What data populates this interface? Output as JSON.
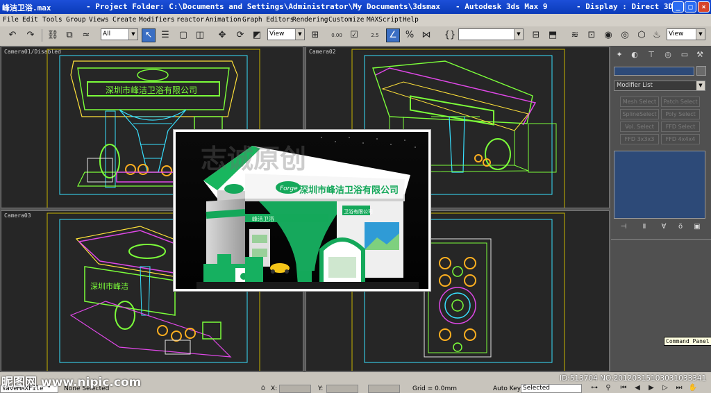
{
  "titlebar": {
    "file": "峰洁卫浴.max",
    "project": "- Project Folder: C:\\Documents and Settings\\Administrator\\My Documents\\3dsmax",
    "app": "- Autodesk 3ds Max 9",
    "display": "- Display : Direct 3D",
    "min_label": "_",
    "max_label": "□",
    "close_label": "×"
  },
  "menubar": [
    "File",
    "Edit",
    "Tools",
    "Group",
    "Views",
    "Create",
    "Modifiers",
    "reactor",
    "Animation",
    "Graph Editors",
    "Rendering",
    "Customize",
    "MAXScript",
    "Help"
  ],
  "toolbar": {
    "selection_filter": "All",
    "ref_coord": "View",
    "spinner_value": "0.00",
    "snap_value": "2.5",
    "named_selection": "",
    "view_right": "View"
  },
  "viewports": {
    "top_left": "Camera01/Disabled",
    "top_right": "Camera02",
    "bottom_left": "Camera03",
    "bottom_right": ""
  },
  "command_panel": {
    "modifier_list": "Modifier List",
    "buttons": [
      "Mesh Select",
      "Patch Select",
      "SplineSelect",
      "Poly Select",
      "Vol. Select",
      "FFD Select",
      "FFD 3x3x3",
      "FFD 4x4x4"
    ],
    "tooltip": "Command Panel"
  },
  "render": {
    "sign_logo": "Forge",
    "sign_company": "深圳市峰洁卫浴有限公司",
    "side_sign": "卫浴有限公司",
    "front_sign": "峰洁卫浴",
    "watermark": "志诚原创"
  },
  "statusbar": {
    "script": "saveMAXFile \"",
    "selection": "None Selected",
    "x_label": "X:",
    "y_label": "Y:",
    "grid": "Grid = 0.0mm",
    "autokey": "Auto Key",
    "selected": "Selected"
  },
  "watermarks": {
    "left": "昵图网 www.nipic.com",
    "right": "ID:513704 NO:20120315103031033341"
  },
  "colors": {
    "titlebar": "#0a3ab8",
    "viewport_bg": "#262626",
    "wire_green": "#7cff3a",
    "wire_yellow": "#ffe23a",
    "wire_magenta": "#e048e8",
    "wire_cyan": "#38e0ff",
    "render_green": "#14a85a"
  }
}
